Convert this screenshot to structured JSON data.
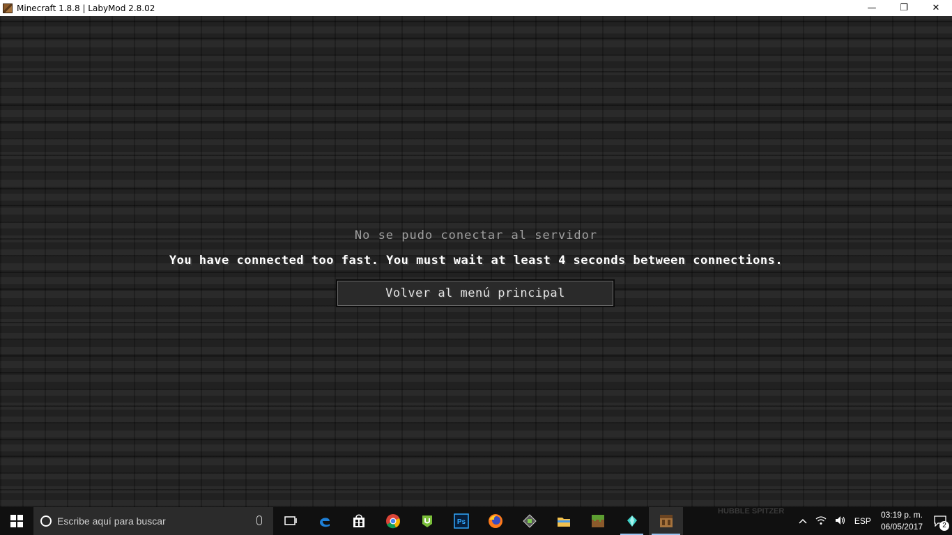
{
  "window": {
    "title": "Minecraft 1.8.8 | LabyMod 2.8.02",
    "minimize": "—",
    "maximize": "❐",
    "close": "✕"
  },
  "screen": {
    "title": "No se pudo conectar al servidor",
    "reason": "You have connected too fast. You must wait at least 4 seconds between connections.",
    "back_button": "Volver al menú principal"
  },
  "taskbar": {
    "search_placeholder": "Escribe aquí para buscar",
    "apps": [
      {
        "name": "task-view-icon"
      },
      {
        "name": "edge-icon"
      },
      {
        "name": "store-icon"
      },
      {
        "name": "chrome-icon"
      },
      {
        "name": "utorrent-icon"
      },
      {
        "name": "photoshop-icon",
        "label": "Ps"
      },
      {
        "name": "firefox-icon"
      },
      {
        "name": "app-icon"
      },
      {
        "name": "file-explorer-icon"
      },
      {
        "name": "minecraft-grass-icon"
      },
      {
        "name": "diamond-icon"
      },
      {
        "name": "minecraft-crafting-icon"
      }
    ],
    "wallpaper_text": "HUBBLE  SPITZER",
    "tray": {
      "language": "ESP",
      "time": "03:19 p. m.",
      "date": "06/05/2017",
      "notifications": "2"
    }
  }
}
